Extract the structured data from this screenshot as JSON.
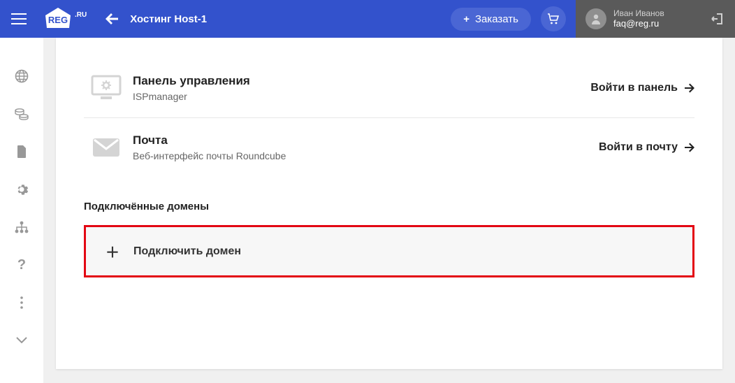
{
  "header": {
    "title": "Хостинг Host-1",
    "order_label": "Заказать"
  },
  "user": {
    "name": "Иван Иванов",
    "email": "faq@reg.ru"
  },
  "tools": {
    "panel": {
      "title": "Панель управления",
      "sub": "ISPmanager",
      "action": "Войти в панель"
    },
    "mail": {
      "title": "Почта",
      "sub": "Веб-интерфейс почты Roundcube",
      "action": "Войти в почту"
    }
  },
  "domains": {
    "section_title": "Подключённые домены",
    "connect_label": "Подключить домен"
  }
}
